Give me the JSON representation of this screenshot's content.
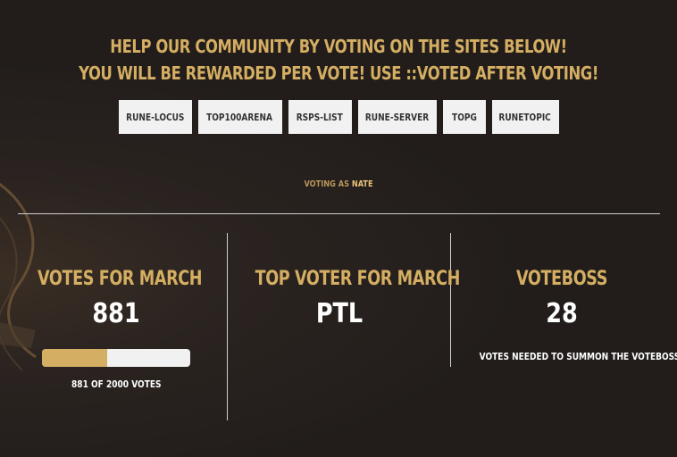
{
  "header": {
    "line1": "HELP OUR COMMUNITY BY VOTING ON THE SITES BELOW!",
    "line2": "YOU WILL BE REWARDED PER VOTE! USE ::VOTED AFTER VOTING!"
  },
  "vote_sites": [
    {
      "label": "RUNE-LOCUS"
    },
    {
      "label": "TOP100ARENA"
    },
    {
      "label": "RSPS-LIST"
    },
    {
      "label": "RUNE-SERVER"
    },
    {
      "label": "TOPG"
    },
    {
      "label": "RUNETOPIC"
    }
  ],
  "voting_as": {
    "prefix": "VOTING AS",
    "username": "NATE"
  },
  "stats": {
    "monthly": {
      "title": "VOTES FOR MARCH",
      "value": "881",
      "progress_fraction": 0.4405,
      "progress_text": "881 OF 2000 VOTES"
    },
    "top_voter": {
      "title": "TOP VOTER FOR MARCH",
      "value": "PTL"
    },
    "voteboss": {
      "title": "VOTEBOSS",
      "value": "28",
      "caption": "VOTES NEEDED TO SUMMON THE VOTEBOSS"
    }
  },
  "colors": {
    "accent_gold": "#d4ae62",
    "background": "#221d1b",
    "button_bg": "#f1f1f1"
  }
}
